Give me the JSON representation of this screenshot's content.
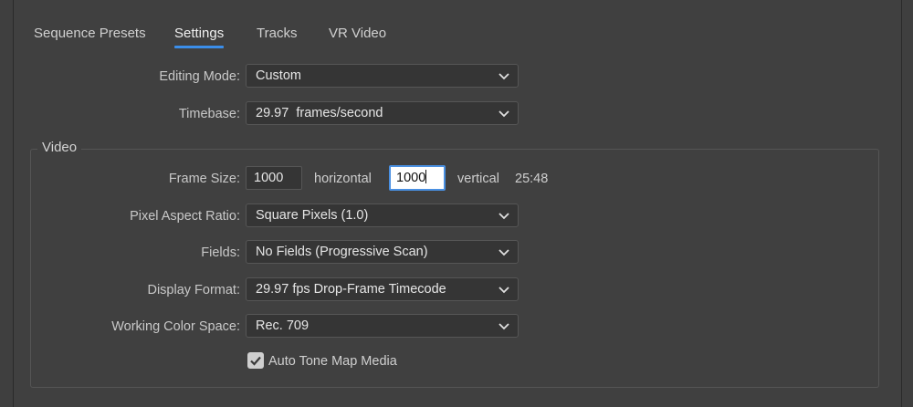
{
  "tabs": [
    {
      "label": "Sequence Presets",
      "active": false
    },
    {
      "label": "Settings",
      "active": true
    },
    {
      "label": "Tracks",
      "active": false
    },
    {
      "label": "VR Video",
      "active": false
    }
  ],
  "editing_mode": {
    "label": "Editing Mode:",
    "value": "Custom"
  },
  "timebase": {
    "label": "Timebase:",
    "value": "29.97  frames/second"
  },
  "video": {
    "title": "Video",
    "frame_size": {
      "label": "Frame Size:",
      "horizontal_value": "1000",
      "horizontal_label": "horizontal",
      "vertical_value": "1000",
      "vertical_label": "vertical",
      "aspect": "25:48"
    },
    "pixel_aspect_ratio": {
      "label": "Pixel Aspect Ratio:",
      "value": "Square Pixels (1.0)"
    },
    "fields": {
      "label": "Fields:",
      "value": "No Fields (Progressive Scan)"
    },
    "display_format": {
      "label": "Display Format:",
      "value": "29.97 fps Drop-Frame Timecode"
    },
    "working_color_space": {
      "label": "Working Color Space:",
      "value": "Rec. 709"
    },
    "auto_tone_map": {
      "label": "Auto Tone Map Media",
      "checked": true
    }
  },
  "colors": {
    "accent": "#3b8eea",
    "background": "#404040"
  }
}
